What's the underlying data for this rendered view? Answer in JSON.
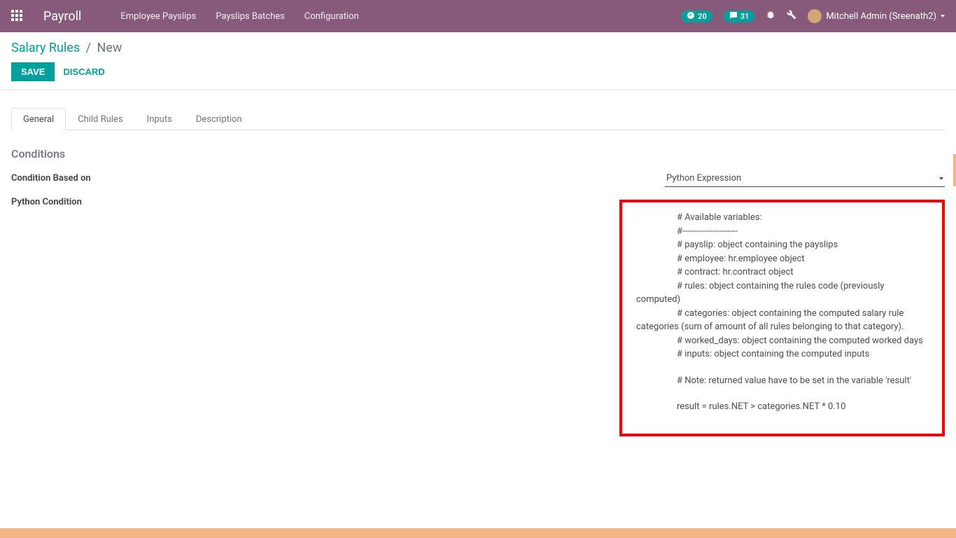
{
  "navbar": {
    "brand": "Payroll",
    "links": [
      "Employee Payslips",
      "Payslips Batches",
      "Configuration"
    ],
    "activity_count": "20",
    "message_count": "31",
    "user_name": "Mitchell Admin (Sreenath2)"
  },
  "breadcrumb": {
    "root": "Salary Rules",
    "current": "New"
  },
  "actions": {
    "save": "Save",
    "discard": "Discard"
  },
  "tabs": [
    "General",
    "Child Rules",
    "Inputs",
    "Description"
  ],
  "section": {
    "title": "Conditions",
    "field_condition_based_on": "Condition Based on",
    "field_python_condition": "Python Condition",
    "condition_value": "Python Expression"
  },
  "python_code": {
    "l1": "# Available variables:",
    "l2": "#----------------------",
    "l3": "# payslip: object containing the payslips",
    "l4": "# employee: hr.employee object",
    "l5": "# contract: hr.contract object",
    "l6": "# rules: object containing the rules code (previously computed)",
    "l7": "# categories: object containing the computed salary rule categories (sum of amount of all rules belonging to that category).",
    "l8": "# worked_days: object containing the computed worked days",
    "l9": "# inputs: object containing the computed inputs",
    "l10": "# Note: returned value have to be set in the variable 'result'",
    "l11": "result = rules.NET > categories.NET * 0.10"
  }
}
